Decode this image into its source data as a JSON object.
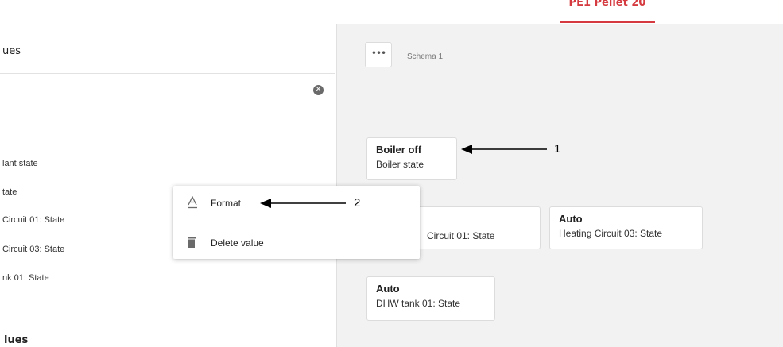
{
  "header": {
    "active_tab": "PE1 Pellet 20",
    "accent_color": "#d43a3f"
  },
  "left_panel": {
    "title": "ues",
    "search": {
      "value": "",
      "clear_icon": "clear-circle-icon"
    },
    "items": [
      {
        "label": "lant state"
      },
      {
        "label": "tate"
      },
      {
        "label": "Circuit 01: State"
      },
      {
        "label": "Circuit 03: State"
      },
      {
        "label": "nk 01: State"
      }
    ],
    "section_title_2": "lues"
  },
  "schema": {
    "more_label": "•••",
    "name": "Schema 1",
    "cards": [
      {
        "value": "Boiler off",
        "label": "Boiler state"
      },
      {
        "value": "",
        "label": "Circuit 01: State"
      },
      {
        "value": "Auto",
        "label": "Heating Circuit 03: State"
      },
      {
        "value": "Auto",
        "label": "DHW tank 01: State"
      }
    ]
  },
  "context_menu": {
    "items": [
      {
        "label": "Format",
        "icon": "text-format-icon"
      },
      {
        "label": "Delete value",
        "icon": "trash-icon"
      }
    ]
  },
  "callouts": [
    {
      "number": "1"
    },
    {
      "number": "2"
    }
  ]
}
